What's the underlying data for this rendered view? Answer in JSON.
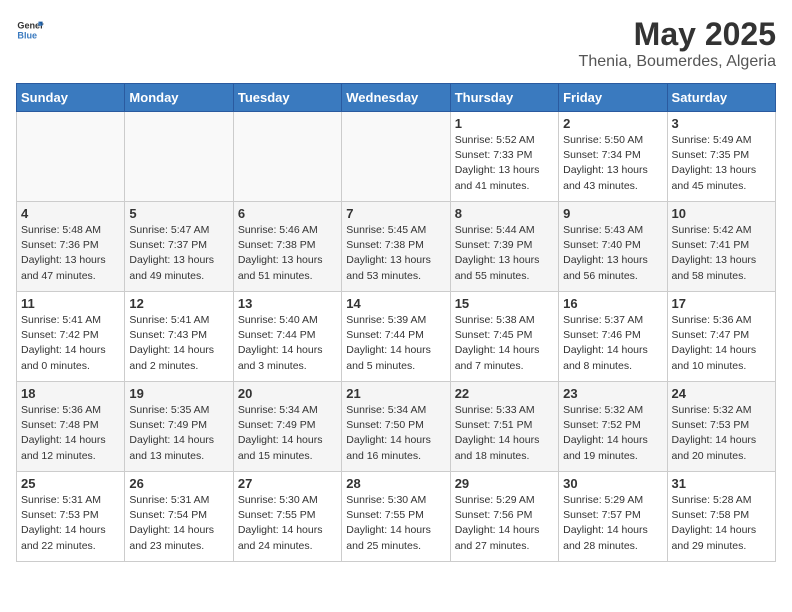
{
  "header": {
    "logo_general": "General",
    "logo_blue": "Blue",
    "title": "May 2025",
    "subtitle": "Thenia, Boumerdes, Algeria"
  },
  "weekdays": [
    "Sunday",
    "Monday",
    "Tuesday",
    "Wednesday",
    "Thursday",
    "Friday",
    "Saturday"
  ],
  "weeks": [
    [
      {
        "day": "",
        "sunrise": "",
        "sunset": "",
        "daylight": ""
      },
      {
        "day": "",
        "sunrise": "",
        "sunset": "",
        "daylight": ""
      },
      {
        "day": "",
        "sunrise": "",
        "sunset": "",
        "daylight": ""
      },
      {
        "day": "",
        "sunrise": "",
        "sunset": "",
        "daylight": ""
      },
      {
        "day": "1",
        "sunrise": "5:52 AM",
        "sunset": "7:33 PM",
        "daylight": "13 hours and 41 minutes."
      },
      {
        "day": "2",
        "sunrise": "5:50 AM",
        "sunset": "7:34 PM",
        "daylight": "13 hours and 43 minutes."
      },
      {
        "day": "3",
        "sunrise": "5:49 AM",
        "sunset": "7:35 PM",
        "daylight": "13 hours and 45 minutes."
      }
    ],
    [
      {
        "day": "4",
        "sunrise": "5:48 AM",
        "sunset": "7:36 PM",
        "daylight": "13 hours and 47 minutes."
      },
      {
        "day": "5",
        "sunrise": "5:47 AM",
        "sunset": "7:37 PM",
        "daylight": "13 hours and 49 minutes."
      },
      {
        "day": "6",
        "sunrise": "5:46 AM",
        "sunset": "7:38 PM",
        "daylight": "13 hours and 51 minutes."
      },
      {
        "day": "7",
        "sunrise": "5:45 AM",
        "sunset": "7:38 PM",
        "daylight": "13 hours and 53 minutes."
      },
      {
        "day": "8",
        "sunrise": "5:44 AM",
        "sunset": "7:39 PM",
        "daylight": "13 hours and 55 minutes."
      },
      {
        "day": "9",
        "sunrise": "5:43 AM",
        "sunset": "7:40 PM",
        "daylight": "13 hours and 56 minutes."
      },
      {
        "day": "10",
        "sunrise": "5:42 AM",
        "sunset": "7:41 PM",
        "daylight": "13 hours and 58 minutes."
      }
    ],
    [
      {
        "day": "11",
        "sunrise": "5:41 AM",
        "sunset": "7:42 PM",
        "daylight": "14 hours and 0 minutes."
      },
      {
        "day": "12",
        "sunrise": "5:41 AM",
        "sunset": "7:43 PM",
        "daylight": "14 hours and 2 minutes."
      },
      {
        "day": "13",
        "sunrise": "5:40 AM",
        "sunset": "7:44 PM",
        "daylight": "14 hours and 3 minutes."
      },
      {
        "day": "14",
        "sunrise": "5:39 AM",
        "sunset": "7:44 PM",
        "daylight": "14 hours and 5 minutes."
      },
      {
        "day": "15",
        "sunrise": "5:38 AM",
        "sunset": "7:45 PM",
        "daylight": "14 hours and 7 minutes."
      },
      {
        "day": "16",
        "sunrise": "5:37 AM",
        "sunset": "7:46 PM",
        "daylight": "14 hours and 8 minutes."
      },
      {
        "day": "17",
        "sunrise": "5:36 AM",
        "sunset": "7:47 PM",
        "daylight": "14 hours and 10 minutes."
      }
    ],
    [
      {
        "day": "18",
        "sunrise": "5:36 AM",
        "sunset": "7:48 PM",
        "daylight": "14 hours and 12 minutes."
      },
      {
        "day": "19",
        "sunrise": "5:35 AM",
        "sunset": "7:49 PM",
        "daylight": "14 hours and 13 minutes."
      },
      {
        "day": "20",
        "sunrise": "5:34 AM",
        "sunset": "7:49 PM",
        "daylight": "14 hours and 15 minutes."
      },
      {
        "day": "21",
        "sunrise": "5:34 AM",
        "sunset": "7:50 PM",
        "daylight": "14 hours and 16 minutes."
      },
      {
        "day": "22",
        "sunrise": "5:33 AM",
        "sunset": "7:51 PM",
        "daylight": "14 hours and 18 minutes."
      },
      {
        "day": "23",
        "sunrise": "5:32 AM",
        "sunset": "7:52 PM",
        "daylight": "14 hours and 19 minutes."
      },
      {
        "day": "24",
        "sunrise": "5:32 AM",
        "sunset": "7:53 PM",
        "daylight": "14 hours and 20 minutes."
      }
    ],
    [
      {
        "day": "25",
        "sunrise": "5:31 AM",
        "sunset": "7:53 PM",
        "daylight": "14 hours and 22 minutes."
      },
      {
        "day": "26",
        "sunrise": "5:31 AM",
        "sunset": "7:54 PM",
        "daylight": "14 hours and 23 minutes."
      },
      {
        "day": "27",
        "sunrise": "5:30 AM",
        "sunset": "7:55 PM",
        "daylight": "14 hours and 24 minutes."
      },
      {
        "day": "28",
        "sunrise": "5:30 AM",
        "sunset": "7:55 PM",
        "daylight": "14 hours and 25 minutes."
      },
      {
        "day": "29",
        "sunrise": "5:29 AM",
        "sunset": "7:56 PM",
        "daylight": "14 hours and 27 minutes."
      },
      {
        "day": "30",
        "sunrise": "5:29 AM",
        "sunset": "7:57 PM",
        "daylight": "14 hours and 28 minutes."
      },
      {
        "day": "31",
        "sunrise": "5:28 AM",
        "sunset": "7:58 PM",
        "daylight": "14 hours and 29 minutes."
      }
    ]
  ],
  "labels": {
    "sunrise": "Sunrise:",
    "sunset": "Sunset:",
    "daylight": "Daylight:"
  }
}
